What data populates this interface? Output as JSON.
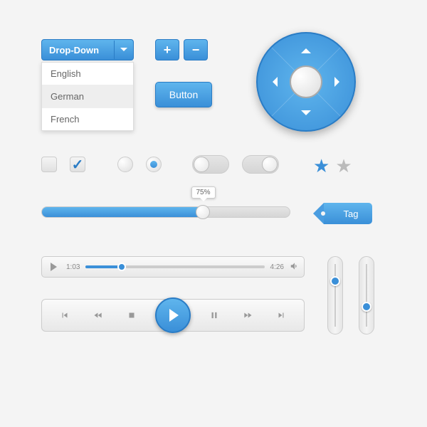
{
  "dropdown": {
    "label": "Drop-Down",
    "items": [
      "English",
      "German",
      "French"
    ],
    "selected_index": 1
  },
  "plus_minus": {
    "plus": "+",
    "minus": "−"
  },
  "button": {
    "label": "Button"
  },
  "checkboxes": [
    {
      "checked": false
    },
    {
      "checked": true
    }
  ],
  "radios": [
    {
      "selected": false
    },
    {
      "selected": true
    }
  ],
  "toggles": [
    {
      "on": true
    },
    {
      "on": false
    }
  ],
  "stars": [
    {
      "filled": true
    },
    {
      "filled": false
    }
  ],
  "progress": {
    "percent_label": "75%",
    "value": 65
  },
  "tag": {
    "label": "Tag"
  },
  "audio": {
    "current": "1:03",
    "total": "4:26",
    "position": 20
  },
  "vsliders": [
    {
      "value": 75
    },
    {
      "value": 42
    }
  ],
  "colors": {
    "accent": "#3a8fd8",
    "accent_light": "#5fb5ed",
    "border": "#2a7cc5"
  }
}
